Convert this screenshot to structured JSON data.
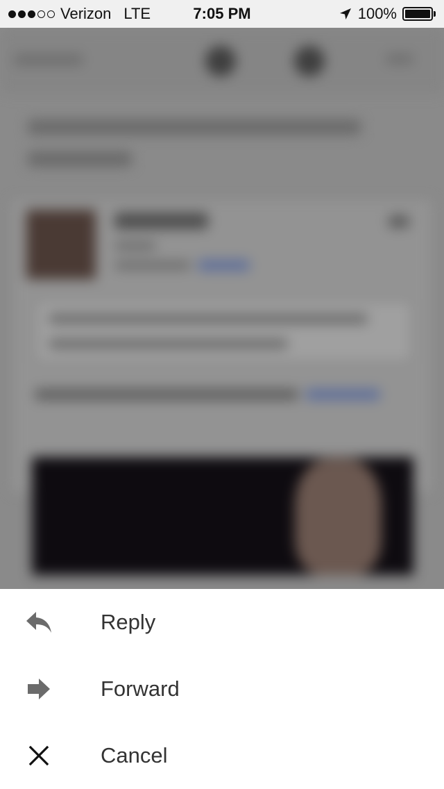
{
  "status_bar": {
    "carrier": "Verizon",
    "network": "LTE",
    "time": "7:05 PM",
    "battery_percent": "100%",
    "signal_bars_filled": 3,
    "signal_bars_total": 5
  },
  "action_sheet": {
    "items": [
      {
        "label": "Reply",
        "icon": "reply-icon"
      },
      {
        "label": "Forward",
        "icon": "forward-icon"
      },
      {
        "label": "Cancel",
        "icon": "close-icon"
      }
    ]
  },
  "colors": {
    "overlay": "#7f7f7f",
    "sheet_background": "#ffffff",
    "icon": "#6b6b6b",
    "label": "#333333"
  }
}
